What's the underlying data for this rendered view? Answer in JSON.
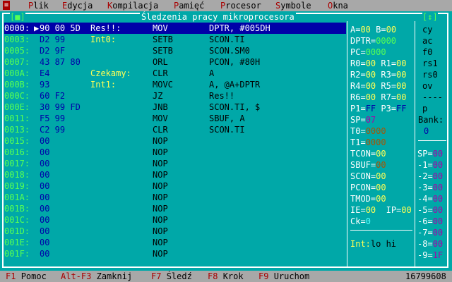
{
  "menu": {
    "system_icon": "≡",
    "items": [
      {
        "hot": "P",
        "rest": "lik"
      },
      {
        "hot": "E",
        "rest": "dycja"
      },
      {
        "hot": "K",
        "rest": "ompilacja"
      },
      {
        "hot": "P",
        "rest": "amięć"
      },
      {
        "hot": "P",
        "rest": "rocesor"
      },
      {
        "hot": "S",
        "rest": "ymbole"
      },
      {
        "hot": "O",
        "rest": "kna"
      }
    ]
  },
  "window": {
    "title": "Śledzenia pracy mikroprocesora",
    "close_btn": "[■]",
    "zoom_btn": "[↕]"
  },
  "code": [
    {
      "addr": "0000:",
      "hex": "90 00 5D",
      "label": "Res!!:",
      "mnem": "MOV",
      "ops": "DPTR, #005DH",
      "selected": true
    },
    {
      "addr": "0003:",
      "hex": "D2 99",
      "label": "Int0:",
      "mnem": "SETB",
      "ops": "SCON.TI"
    },
    {
      "addr": "0005:",
      "hex": "D2 9F",
      "label": "",
      "mnem": "SETB",
      "ops": "SCON.SM0"
    },
    {
      "addr": "0007:",
      "hex": "43 87 80",
      "label": "",
      "mnem": "ORL",
      "ops": "PCON, #80H"
    },
    {
      "addr": "000A:",
      "hex": "E4",
      "label": "Czekamy:",
      "mnem": "CLR",
      "ops": "A"
    },
    {
      "addr": "000B:",
      "hex": "93",
      "label": "Int1:",
      "mnem": "MOVC",
      "ops": "A, @A+DPTR"
    },
    {
      "addr": "000C:",
      "hex": "60 F2",
      "label": "",
      "mnem": "JZ",
      "ops": "Res!!"
    },
    {
      "addr": "000E:",
      "hex": "30 99 FD",
      "label": "",
      "mnem": "JNB",
      "ops": "SCON.TI, $"
    },
    {
      "addr": "0011:",
      "hex": "F5 99",
      "label": "",
      "mnem": "MOV",
      "ops": "SBUF, A"
    },
    {
      "addr": "0013:",
      "hex": "C2 99",
      "label": "",
      "mnem": "CLR",
      "ops": "SCON.TI"
    },
    {
      "addr": "0015:",
      "hex": "00",
      "label": "",
      "mnem": "NOP",
      "ops": ""
    },
    {
      "addr": "0016:",
      "hex": "00",
      "label": "",
      "mnem": "NOP",
      "ops": ""
    },
    {
      "addr": "0017:",
      "hex": "00",
      "label": "",
      "mnem": "NOP",
      "ops": ""
    },
    {
      "addr": "0018:",
      "hex": "00",
      "label": "",
      "mnem": "NOP",
      "ops": ""
    },
    {
      "addr": "0019:",
      "hex": "00",
      "label": "",
      "mnem": "NOP",
      "ops": ""
    },
    {
      "addr": "001A:",
      "hex": "00",
      "label": "",
      "mnem": "NOP",
      "ops": ""
    },
    {
      "addr": "001B:",
      "hex": "00",
      "label": "",
      "mnem": "NOP",
      "ops": ""
    },
    {
      "addr": "001C:",
      "hex": "00",
      "label": "",
      "mnem": "NOP",
      "ops": ""
    },
    {
      "addr": "001D:",
      "hex": "00",
      "label": "",
      "mnem": "NOP",
      "ops": ""
    },
    {
      "addr": "001E:",
      "hex": "00",
      "label": "",
      "mnem": "NOP",
      "ops": ""
    },
    {
      "addr": "001F:",
      "hex": "00",
      "label": "",
      "mnem": "NOP",
      "ops": ""
    }
  ],
  "registers": {
    "A": "00",
    "B": "00",
    "DPTR": "0000",
    "PC": "0000",
    "R0": "00",
    "R1": "00",
    "R2": "00",
    "R3": "00",
    "R4": "00",
    "R5": "00",
    "R6": "00",
    "R7": "00",
    "P1": "FF",
    "P3": "FF",
    "SP": "07",
    "T0": "0000",
    "T1": "0000",
    "TCON": "00",
    "SBUF": "00",
    "SCON": "00",
    "PCON": "00",
    "TMOD": "00",
    "IE": "00",
    "IP": "00",
    "Ck": "0",
    "int_label": "Int:",
    "int_value": "lo hi"
  },
  "flags": [
    "cy",
    "ac",
    "f0",
    "rs1",
    "rs0",
    "ov",
    "----",
    "p"
  ],
  "bank": {
    "label": "Bank:",
    "value": "0"
  },
  "stack": [
    {
      "n": "SP=",
      "v": "00"
    },
    {
      "n": "-1=",
      "v": "00"
    },
    {
      "n": "-2=",
      "v": "00"
    },
    {
      "n": "-3=",
      "v": "00"
    },
    {
      "n": "-4=",
      "v": "00"
    },
    {
      "n": "-5=",
      "v": "00"
    },
    {
      "n": "-6=",
      "v": "00"
    },
    {
      "n": "-7=",
      "v": "00"
    },
    {
      "n": "-8=",
      "v": "00"
    },
    {
      "n": "-9=",
      "v": "1F"
    }
  ],
  "status": {
    "f1_key": "F1",
    "f1_label": "Pomoc",
    "alt_key": "Alt-F3",
    "alt_label": "Zamknij",
    "f7_key": "F7",
    "f7_label": "Śledź",
    "f8_key": "F8",
    "f8_label": "Krok",
    "f9_key": "F9",
    "f9_label": "Uruchom",
    "counter": "16799608"
  }
}
